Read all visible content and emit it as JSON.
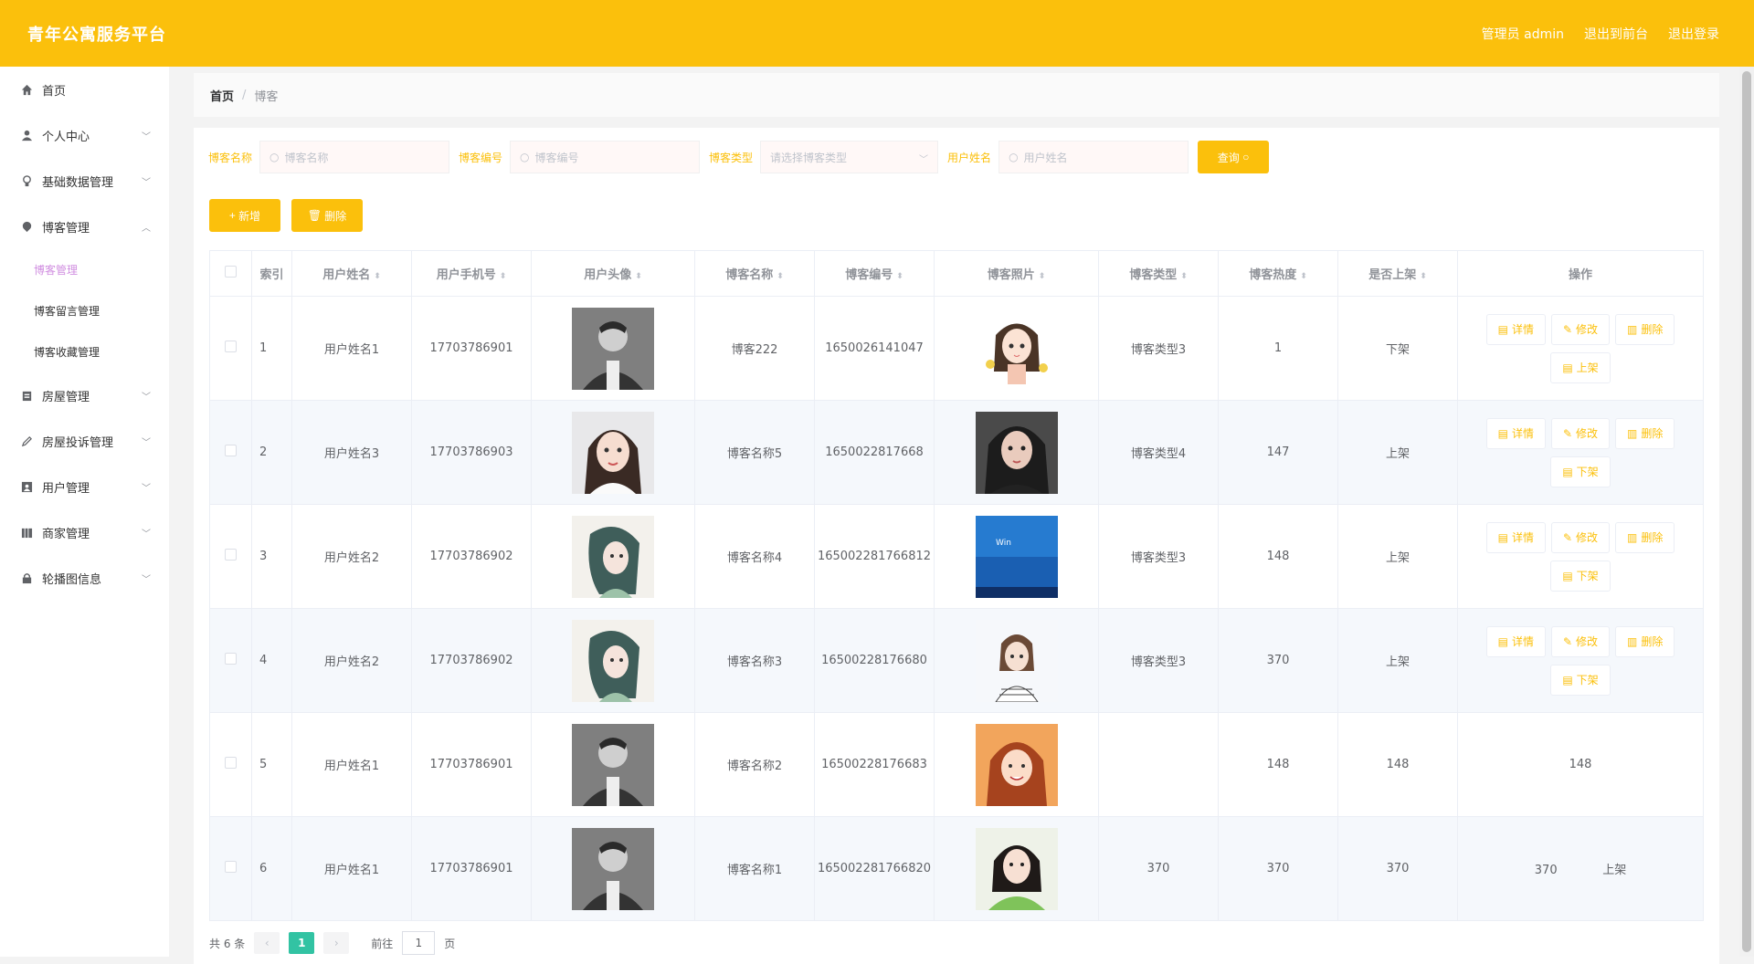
{
  "header": {
    "title": "青年公寓服务平台",
    "admin": "管理员 admin",
    "back": "退出到前台",
    "logout": "退出登录"
  },
  "sidebar": {
    "items": [
      {
        "label": "首页",
        "icon": "home-icon"
      },
      {
        "label": "个人中心",
        "icon": "user-icon"
      },
      {
        "label": "基础数据管理",
        "icon": "bulb-icon"
      },
      {
        "label": "博客管理",
        "icon": "location-icon"
      },
      {
        "label": "房屋管理",
        "icon": "clipboard-icon"
      },
      {
        "label": "房屋投诉管理",
        "icon": "pen-icon"
      },
      {
        "label": "用户管理",
        "icon": "user-box-icon"
      },
      {
        "label": "商家管理",
        "icon": "shop-icon"
      },
      {
        "label": "轮播图信息",
        "icon": "lock-icon"
      }
    ],
    "sub": [
      "博客管理",
      "博客留言管理",
      "博客收藏管理"
    ]
  },
  "breadcrumb": {
    "home": "首页",
    "current": "博客"
  },
  "search": {
    "name_label": "博客名称",
    "name_ph": "博客名称",
    "no_label": "博客编号",
    "no_ph": "博客编号",
    "type_label": "博客类型",
    "type_ph": "请选择博客类型",
    "user_label": "用户姓名",
    "user_ph": "用户姓名",
    "query": "查询"
  },
  "actions": {
    "add": "新增",
    "delete": "删除"
  },
  "table": {
    "headers": [
      "索引",
      "用户姓名",
      "用户手机号",
      "用户头像",
      "博客名称",
      "博客编号",
      "博客照片",
      "博客类型",
      "博客热度",
      "是否上架",
      "操作"
    ],
    "ops": {
      "detail": "详情",
      "edit": "修改",
      "delete": "删除",
      "up": "上架",
      "down": "下架"
    },
    "rows": [
      {
        "idx": "1",
        "name": "用户姓名1",
        "phone": "17703786901",
        "blog": "博客222",
        "no": "1650026141047",
        "type": "博客类型3",
        "heat": "1",
        "status": "下架",
        "toggle": "上架"
      },
      {
        "idx": "2",
        "name": "用户姓名3",
        "phone": "17703786903",
        "blog": "博客名称5",
        "no": "1650022817668",
        "type": "博客类型4",
        "heat": "147",
        "status": "上架",
        "toggle": "下架"
      },
      {
        "idx": "3",
        "name": "用户姓名2",
        "phone": "17703786902",
        "blog": "博客名称4",
        "no": "165002281766812",
        "type": "博客类型3",
        "heat": "148",
        "status": "上架",
        "toggle": "下架"
      },
      {
        "idx": "4",
        "name": "用户姓名2",
        "phone": "17703786902",
        "blog": "博客名称3",
        "no": "16500228176680",
        "type": "博客类型3",
        "heat": "370",
        "status": "上架",
        "toggle": "下架"
      },
      {
        "idx": "5",
        "name": "用户姓名1",
        "phone": "17703786901",
        "blog": "博客名称2",
        "no": "16500228176683",
        "c1": "148",
        "c2": "148",
        "c3": "148"
      },
      {
        "idx": "6",
        "name": "用户姓名1",
        "phone": "17703786901",
        "blog": "博客名称1",
        "no": "165002281766820",
        "c0": "370",
        "c1": "370",
        "c2": "370",
        "c3": "370",
        "c4": "上架"
      }
    ]
  },
  "pager": {
    "total": "共 6 条",
    "page": "1",
    "goto": "前往",
    "page_input": "1",
    "page_unit": "页"
  }
}
